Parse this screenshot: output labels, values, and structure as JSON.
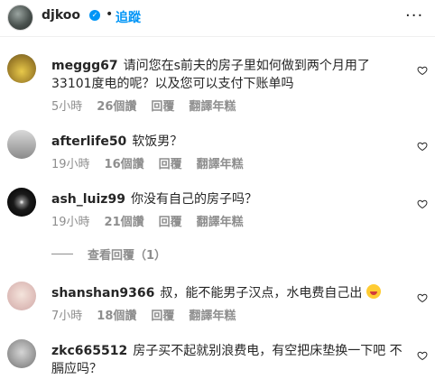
{
  "header": {
    "username": "djkoo",
    "dot": "•",
    "follow_label": "追蹤",
    "more": "···"
  },
  "icons": {
    "verified": "verified-badge-icon",
    "heart": "heart-outline-icon",
    "more": "more-options-icon"
  },
  "comments": [
    {
      "username": "meggg67",
      "text": "请问您在s前夫的房子里如何做到两个月用了33101度电的呢？以及您可以支付下账单吗",
      "time": "5小時",
      "likes": "26個讚",
      "reply": "回覆",
      "translate": "翻譯年糕"
    },
    {
      "username": "afterlife50",
      "text": "软饭男？",
      "time": "19小時",
      "likes": "16個讚",
      "reply": "回覆",
      "translate": "翻譯年糕"
    },
    {
      "username": "ash_luiz99",
      "text": "你没有自己的房子吗？",
      "time": "19小時",
      "likes": "21個讚",
      "reply": "回覆",
      "translate": "翻譯年糕"
    },
    {
      "username": "shanshan9366",
      "text": "叔，能不能男子汉点，水电费自己出",
      "time": "7小時",
      "likes": "18個讚",
      "reply": "回覆",
      "translate": "翻譯年糕"
    },
    {
      "username": "zkc665512",
      "text": "房子买不起就别浪费电，有空把床垫换一下吧 不膈应吗？"
    }
  ],
  "view_replies_label": "查看回覆（1）"
}
